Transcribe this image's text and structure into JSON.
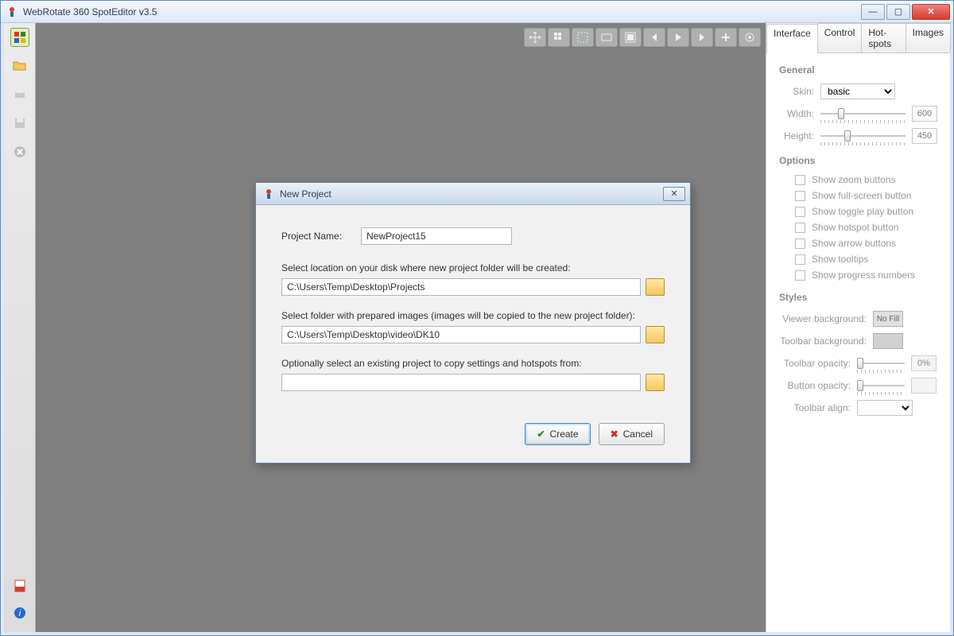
{
  "window": {
    "title": "WebRotate 360 SpotEditor v3.5"
  },
  "sidepanel": {
    "tabs": [
      "Interface",
      "Control",
      "Hot-spots",
      "Images"
    ],
    "general_heading": "General",
    "skin_label": "Skin:",
    "skin_value": "basic",
    "width_label": "Width:",
    "width_value": "600",
    "height_label": "Height:",
    "height_value": "450",
    "options_heading": "Options",
    "options": [
      "Show zoom buttons",
      "Show full-screen button",
      "Show toggle play button",
      "Show hotspot button",
      "Show arrow buttons",
      "Show tooltips",
      "Show progress numbers"
    ],
    "styles_heading": "Styles",
    "viewer_bg_label": "Viewer background:",
    "viewer_bg_value": "No Fill",
    "toolbar_bg_label": "Toolbar background:",
    "toolbar_opacity_label": "Toolbar opacity:",
    "toolbar_opacity_value": "0%",
    "button_opacity_label": "Button opacity:",
    "toolbar_align_label": "Toolbar align:"
  },
  "dialog": {
    "title": "New Project",
    "project_name_label": "Project Name:",
    "project_name_value": "NewProject15",
    "location_instr": "Select location on your disk where new project folder will be created:",
    "location_value": "C:\\Users\\Temp\\Desktop\\Projects",
    "images_instr": "Select folder with prepared images (images will be copied to the new project folder):",
    "images_value": "C:\\Users\\Temp\\Desktop\\video\\DK10",
    "copyfrom_instr": "Optionally select an existing project to copy settings and hotspots from:",
    "copyfrom_value": "",
    "create_label": "Create",
    "cancel_label": "Cancel"
  }
}
